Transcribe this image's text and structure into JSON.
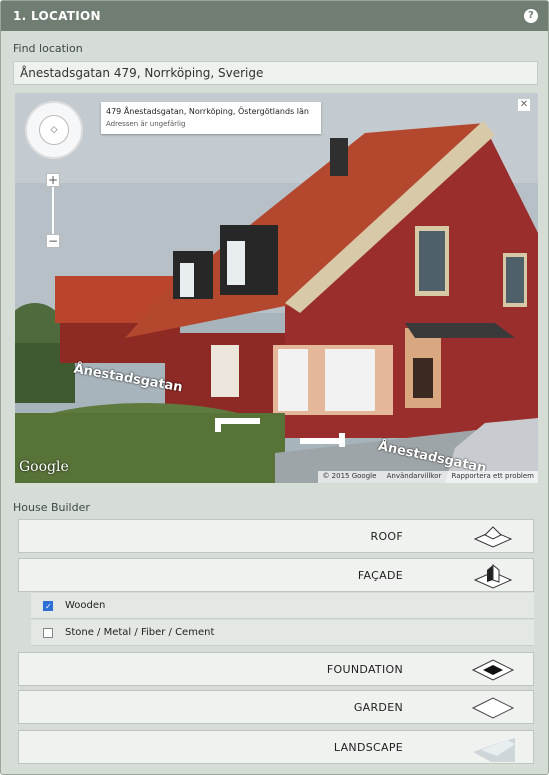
{
  "header": {
    "title": "1. LOCATION",
    "help_icon": "?"
  },
  "find_location": {
    "label": "Find location",
    "value": "Ånestadsgatan 479, Norrköping, Sverige"
  },
  "streetview": {
    "address_title": "479 Ånestadsgatan, Norrköping, Östergötlands län",
    "address_sub": "Adressen är ungefärlig",
    "road_label_left": "Ånestadsgatan",
    "road_label_right": "Ånestadsgatan",
    "logo": "Google",
    "copyright": "© 2015 Google",
    "terms": "Användarvillkor",
    "report": "Rapportera ett problem",
    "zoom_in": "+",
    "zoom_out": "−",
    "close": "✕"
  },
  "house_builder": {
    "label": "House Builder",
    "sections": [
      {
        "label": "ROOF",
        "icon": "roof-icon"
      },
      {
        "label": "FAÇADE",
        "icon": "facade-icon"
      },
      {
        "label": "FOUNDATION",
        "icon": "foundation-icon"
      },
      {
        "label": "GARDEN",
        "icon": "garden-icon"
      },
      {
        "label": "LANDSCAPE",
        "icon": "landscape-icon"
      }
    ],
    "facade_options": [
      {
        "label": "Wooden",
        "checked": true
      },
      {
        "label": "Stone / Metal / Fiber / Cement",
        "checked": false
      }
    ]
  }
}
